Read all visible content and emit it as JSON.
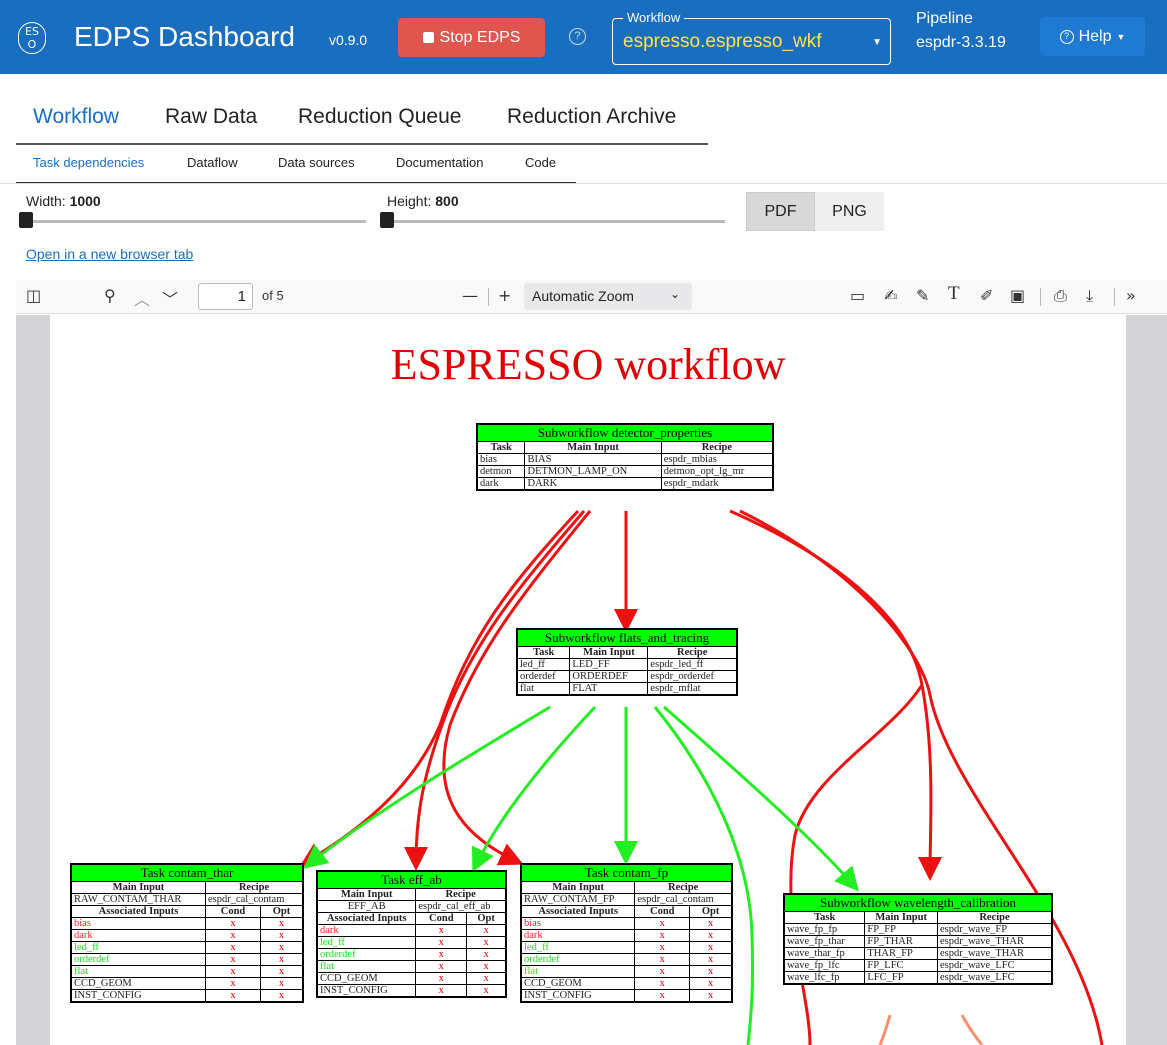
{
  "app": {
    "logo_text": "ES O",
    "title": "EDPS Dashboard",
    "version": "v0.9.0",
    "stop_label": "Stop EDPS",
    "workflow_legend": "Workflow",
    "workflow_value": "espresso.espresso_wkf",
    "pipeline_label": "Pipeline",
    "pipeline_value": "espdr-3.3.19",
    "help_label": "Help"
  },
  "main_tabs": [
    "Workflow",
    "Raw Data",
    "Reduction Queue",
    "Reduction Archive"
  ],
  "sub_tabs": [
    "Task dependencies",
    "Dataflow",
    "Data sources",
    "Documentation",
    "Code"
  ],
  "controls": {
    "width_label": "Width:",
    "width_value": "1000",
    "height_label": "Height:",
    "height_value": "800",
    "pdf_label": "PDF",
    "png_label": "PNG",
    "open_link": "Open in a new browser tab"
  },
  "pdf_toolbar": {
    "page": "1",
    "page_of": "of 5",
    "zoom": "Automatic Zoom"
  },
  "graph": {
    "title": "ESPRESSO workflow",
    "detector": {
      "title": "Subworkflow detector_properties",
      "headers": [
        "Task",
        "Main Input",
        "Recipe"
      ],
      "rows": [
        [
          "bias",
          "BIAS",
          "espdr_mbias"
        ],
        [
          "detmon",
          "DETMON_LAMP_ON",
          "detmon_opt_lg_mr"
        ],
        [
          "dark",
          "DARK",
          "espdr_mdark"
        ]
      ]
    },
    "flats": {
      "title": "Subworkflow flats_and_tracing",
      "headers": [
        "Task",
        "Main Input",
        "Recipe"
      ],
      "rows": [
        [
          "led_ff",
          "LED_FF",
          "espdr_led_ff"
        ],
        [
          "orderdef",
          "ORDERDEF",
          "espdr_orderdef"
        ],
        [
          "flat",
          "FLAT",
          "espdr_mflat"
        ]
      ]
    },
    "contam_thar": {
      "title": "Task contam_thar",
      "main_headers": [
        "Main Input",
        "Recipe"
      ],
      "main_row": [
        "RAW_CONTAM_THAR",
        "espdr_cal_contam"
      ],
      "assoc_headers": [
        "Associated Inputs",
        "Cond",
        "Opt"
      ],
      "assoc": [
        "bias",
        "dark",
        "led_ff",
        "orderdef",
        "flat",
        "CCD_GEOM",
        "INST_CONFIG"
      ]
    },
    "eff_ab": {
      "title": "Task eff_ab",
      "main_headers": [
        "Main Input",
        "Recipe"
      ],
      "main_row": [
        "EFF_AB",
        "espdr_cal_eff_ab"
      ],
      "assoc_headers": [
        "Associated Inputs",
        "Cond",
        "Opt"
      ],
      "assoc": [
        "dark",
        "led_ff",
        "orderdef",
        "flat",
        "CCD_GEOM",
        "INST_CONFIG"
      ]
    },
    "contam_fp": {
      "title": "Task contam_fp",
      "main_headers": [
        "Main Input",
        "Recipe"
      ],
      "main_row": [
        "RAW_CONTAM_FP",
        "espdr_cal_contam"
      ],
      "assoc_headers": [
        "Associated Inputs",
        "Cond",
        "Opt"
      ],
      "assoc": [
        "bias",
        "dark",
        "led_ff",
        "orderdef",
        "flat",
        "CCD_GEOM",
        "INST_CONFIG"
      ]
    },
    "wavelength": {
      "title": "Subworkflow wavelength_calibration",
      "headers": [
        "Task",
        "Main Input",
        "Recipe"
      ],
      "rows": [
        [
          "wave_fp_fp",
          "FP_FP",
          "espdr_wave_FP"
        ],
        [
          "wave_fp_thar",
          "FP_THAR",
          "espdr_wave_THAR"
        ],
        [
          "wave_thar_fp",
          "THAR_FP",
          "espdr_wave_THAR"
        ],
        [
          "wave_fp_lfc",
          "FP_LFC",
          "espdr_wave_LFC"
        ],
        [
          "wave_lfc_fp",
          "LFC_FP",
          "espdr_wave_LFC"
        ]
      ]
    },
    "cell_mark": "x",
    "colors": {
      "red_edge": "#ee1111",
      "green_edge": "#22ee22",
      "node_header": "#00ff00",
      "title": "#e00000"
    }
  }
}
